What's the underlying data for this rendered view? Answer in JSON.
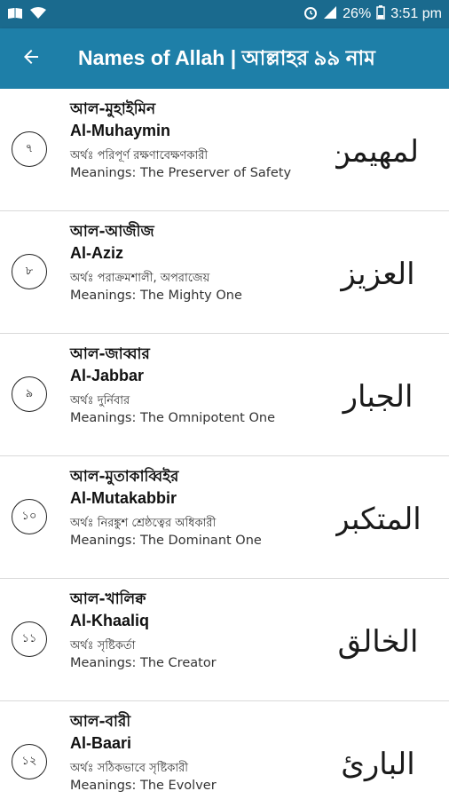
{
  "status_bar": {
    "battery": "26%",
    "time": "3:51 pm"
  },
  "app_bar": {
    "title": "Names of Allah | আল্লাহর ৯৯ নাম",
    "back_icon": "arrow-left-icon"
  },
  "names": [
    {
      "number": "৭",
      "bn_name": "আল-মুহাইমিন",
      "en_name": "Al-Muhaymin",
      "bn_meaning": "অর্থঃ পরিপূর্ণ রক্ষণাবেক্ষণকারী",
      "en_meaning": "Meanings: The Preserver of Safety",
      "arabic": "المهيمن"
    },
    {
      "number": "৮",
      "bn_name": "আল-আজীজ",
      "en_name": "Al-Aziz",
      "bn_meaning": "অর্থঃ পরাক্রমশালী, অপরাজেয়",
      "en_meaning": "Meanings: The Mighty One",
      "arabic": "العزيز"
    },
    {
      "number": "৯",
      "bn_name": "আল-জাব্বার",
      "en_name": "Al-Jabbar",
      "bn_meaning": "অর্থঃ দুর্নিবার",
      "en_meaning": "Meanings: The Omnipotent One",
      "arabic": "الجبار"
    },
    {
      "number": "১০",
      "bn_name": "আল-মুতাকাব্বিইর",
      "en_name": "Al-Mutakabbir",
      "bn_meaning": "অর্থঃ নিরঙ্কুশ শ্রেষ্ঠত্বের অধিকারী",
      "en_meaning": "Meanings: The Dominant One",
      "arabic": "المتكبر"
    },
    {
      "number": "১১",
      "bn_name": "আল-খালিক্ব",
      "en_name": "Al-Khaaliq",
      "bn_meaning": "অর্থঃ সৃষ্টিকর্তা",
      "en_meaning": "Meanings: The Creator",
      "arabic": "الخالق"
    },
    {
      "number": "১২",
      "bn_name": "আল-বারী",
      "en_name": "Al-Baari",
      "bn_meaning": "অর্থঃ সঠিকভাবে সৃষ্টিকারী",
      "en_meaning": "Meanings: The Evolver",
      "arabic": "البارئ"
    }
  ]
}
